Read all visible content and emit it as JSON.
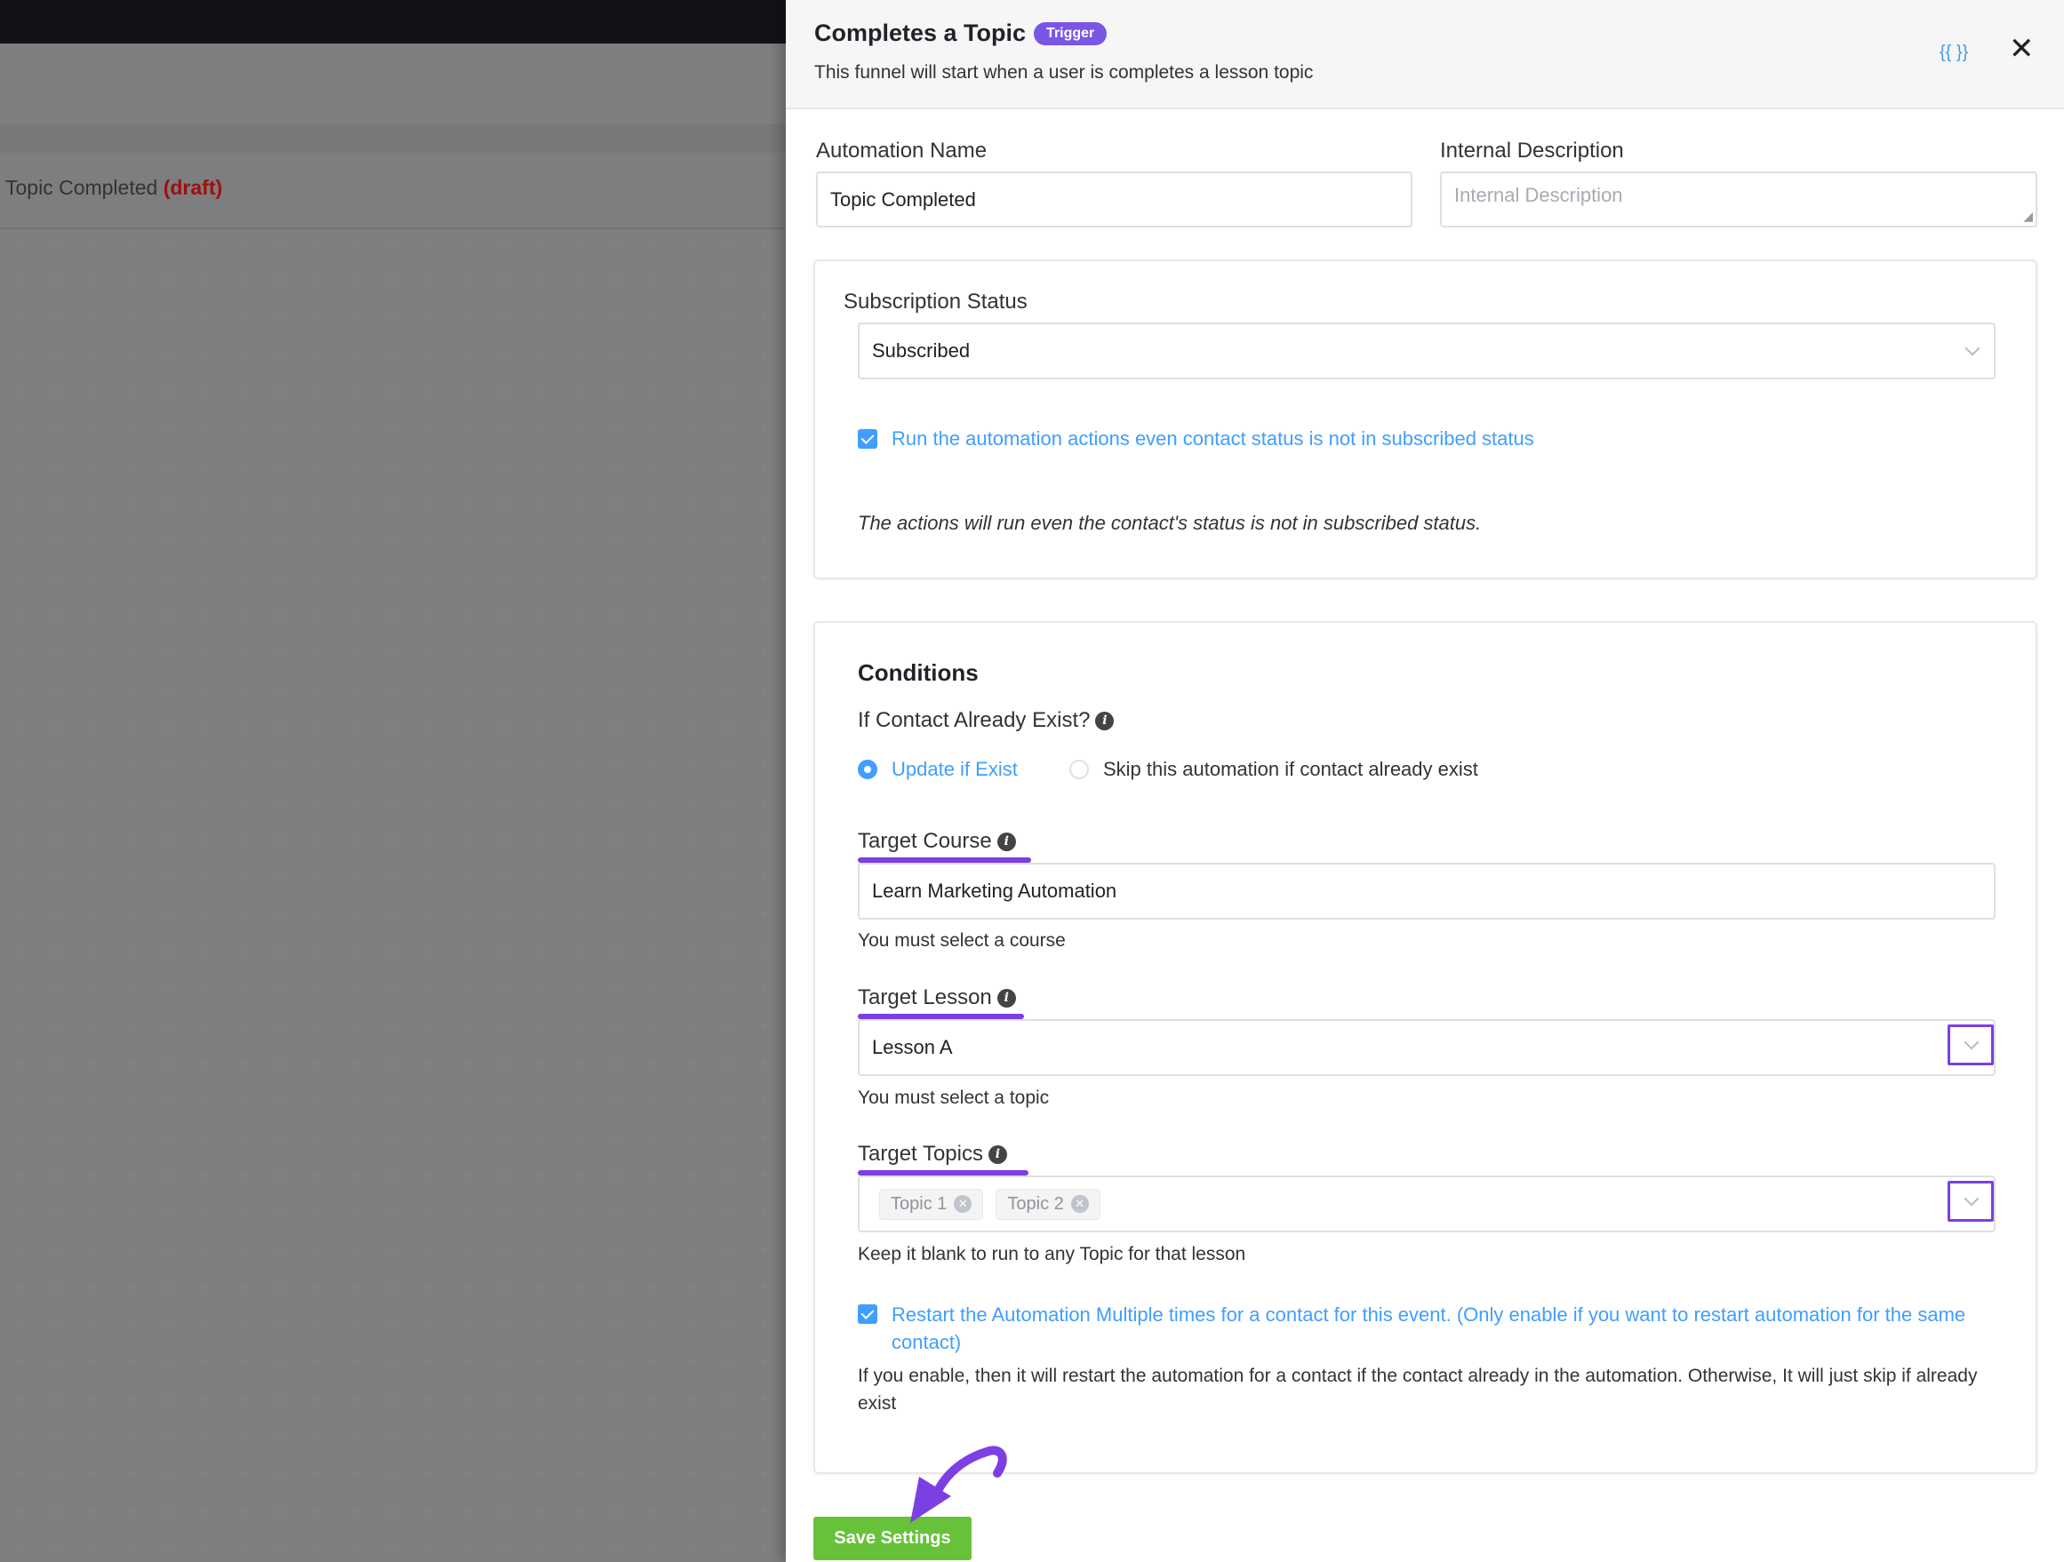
{
  "background": {
    "automation_title": "Topic Completed",
    "draft_label": "(draft)"
  },
  "header": {
    "title": "Completes a Topic",
    "badge": "Trigger",
    "description": "This funnel will start when a user is completes a lesson topic",
    "code_icon_text": "{{ }}",
    "close_icon": "close-icon"
  },
  "form": {
    "automation_name": {
      "label": "Automation Name",
      "value": "Topic Completed"
    },
    "internal_description": {
      "label": "Internal Description",
      "placeholder": "Internal Description",
      "value": ""
    },
    "subscription": {
      "label": "Subscription Status",
      "value": "Subscribed",
      "run_checkbox_label": "Run the automation actions even contact status is not in subscribed status",
      "run_checked": true,
      "note": "The actions will run even the contact's status is not in subscribed status."
    },
    "conditions": {
      "title": "Conditions",
      "contact_exist_label": "If Contact Already Exist?",
      "radio_update": "Update if Exist",
      "radio_skip": "Skip this automation if contact already exist",
      "selected": "Update if Exist",
      "target_course": {
        "label": "Target Course",
        "value": "Learn Marketing Automation",
        "help": "You must select a course"
      },
      "target_lesson": {
        "label": "Target Lesson",
        "value": "Lesson A",
        "help": "You must select a topic"
      },
      "target_topics": {
        "label": "Target Topics",
        "tags": [
          "Topic 1",
          "Topic 2"
        ],
        "help": "Keep it blank to run to any Topic for that lesson"
      },
      "restart_label": "Restart the Automation Multiple times for a contact for this event. (Only enable if you want to restart automation for the same contact)",
      "restart_checked": true,
      "restart_help": "If you enable, then it will restart the automation for a contact if the contact already in the automation. Otherwise, It will just skip if already exist"
    },
    "save_label": "Save Settings"
  },
  "colors": {
    "accent": "#409eff",
    "badge": "#7b55e6",
    "save": "#67c23a",
    "annotation": "#7b3fe4",
    "draft": "#a00f0f"
  }
}
